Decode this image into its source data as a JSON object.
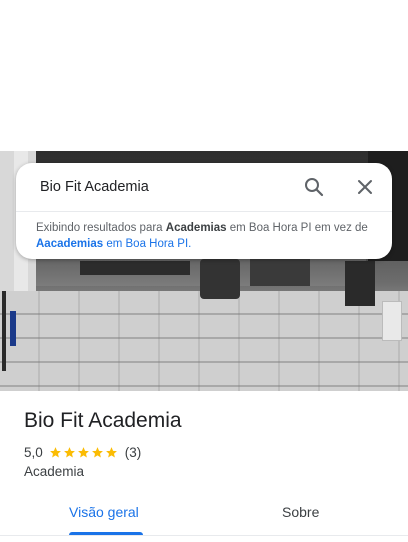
{
  "search": {
    "query": "Bio Fit Academia",
    "notice": {
      "showing_prefix": "Exibindo resultados para",
      "showing_term": "Academias",
      "showing_suffix": "em Boa Hora PI em",
      "instead_prefix": "vez de",
      "instead_term": "Aacademias",
      "instead_suffix": "em Boa Hora PI."
    }
  },
  "place": {
    "name": "Bio Fit Academia",
    "rating": "5,0",
    "stars": 5,
    "reviews": "(3)",
    "category": "Academia"
  },
  "tabs": [
    {
      "label": "Visão geral",
      "active": true
    },
    {
      "label": "Sobre",
      "active": false
    }
  ],
  "colors": {
    "accent": "#1a73e8",
    "star": "#fbbc04"
  }
}
